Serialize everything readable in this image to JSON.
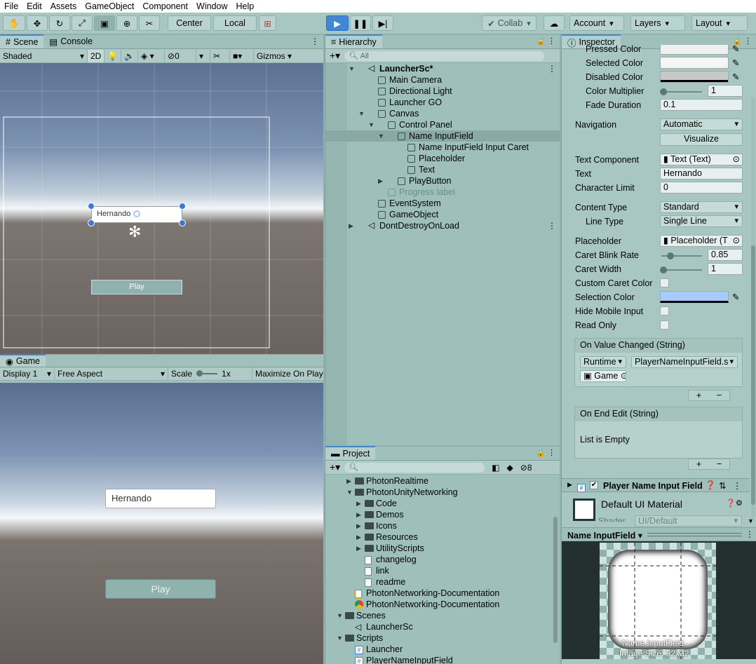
{
  "menu": [
    "File",
    "Edit",
    "Assets",
    "GameObject",
    "Component",
    "Window",
    "Help"
  ],
  "toolbar": {
    "center_label": "Center",
    "local_label": "Local",
    "collab_label": "Collab",
    "account_label": "Account",
    "layers_label": "Layers",
    "layout_label": "Layout"
  },
  "scene": {
    "tab_scene": "Scene",
    "tab_console": "Console",
    "shading": "Shaded",
    "mode_2d": "2D",
    "hidden_count": "0",
    "gizmos": "Gizmos",
    "input_text": "Hernando",
    "play_label": "Play"
  },
  "game": {
    "tab": "Game",
    "display": "Display 1",
    "aspect": "Free Aspect",
    "scale_label": "Scale",
    "scale_value": "1x",
    "maximize": "Maximize On Play",
    "input_text": "Hernando",
    "play_label": "Play"
  },
  "hierarchy": {
    "tab": "Hierarchy",
    "search_placeholder": "All",
    "items": [
      {
        "label": "LauncherSc*",
        "depth": 0,
        "expanded": true,
        "bold": true,
        "scene": true
      },
      {
        "label": "Main Camera",
        "depth": 1
      },
      {
        "label": "Directional Light",
        "depth": 1
      },
      {
        "label": "Launcher GO",
        "depth": 1
      },
      {
        "label": "Canvas",
        "depth": 1,
        "expanded": true
      },
      {
        "label": "Control Panel",
        "depth": 2,
        "expanded": true
      },
      {
        "label": "Name InputField",
        "depth": 3,
        "expanded": true,
        "selected": true
      },
      {
        "label": "Name InputField Input Caret",
        "depth": 4
      },
      {
        "label": "Placeholder",
        "depth": 4
      },
      {
        "label": "Text",
        "depth": 4
      },
      {
        "label": "PlayButton",
        "depth": 3,
        "collapsed": true
      },
      {
        "label": "Progress label",
        "depth": 2,
        "disabled": true
      },
      {
        "label": "EventSystem",
        "depth": 1
      },
      {
        "label": "GameObject",
        "depth": 1
      },
      {
        "label": "DontDestroyOnLoad",
        "depth": 0,
        "collapsed": true,
        "scene": true
      }
    ]
  },
  "project": {
    "tab": "Project",
    "hidden_count": "8",
    "items": [
      {
        "label": "PhotonRealtime",
        "depth": 1,
        "type": "folder",
        "arrow": "▶"
      },
      {
        "label": "PhotonUnityNetworking",
        "depth": 1,
        "type": "folder",
        "arrow": "▼"
      },
      {
        "label": "Code",
        "depth": 2,
        "type": "folder",
        "arrow": "▶"
      },
      {
        "label": "Demos",
        "depth": 2,
        "type": "folder",
        "arrow": "▶"
      },
      {
        "label": "Icons",
        "depth": 2,
        "type": "folder",
        "arrow": "▶"
      },
      {
        "label": "Resources",
        "depth": 2,
        "type": "folder",
        "arrow": "▶"
      },
      {
        "label": "UtilityScripts",
        "depth": 2,
        "type": "folder",
        "arrow": "▶"
      },
      {
        "label": "changelog",
        "depth": 2,
        "type": "file"
      },
      {
        "label": "link",
        "depth": 2,
        "type": "file"
      },
      {
        "label": "readme",
        "depth": 2,
        "type": "file"
      },
      {
        "label": "PhotonNetworking-Documentation",
        "depth": 1,
        "type": "doc"
      },
      {
        "label": "PhotonNetworking-Documentation",
        "depth": 1,
        "type": "chrome"
      },
      {
        "label": "Scenes",
        "depth": 0,
        "type": "folder",
        "arrow": "▼"
      },
      {
        "label": "LauncherSc",
        "depth": 1,
        "type": "scene"
      },
      {
        "label": "Scripts",
        "depth": 0,
        "type": "folder",
        "arrow": "▼"
      },
      {
        "label": "Launcher",
        "depth": 1,
        "type": "script"
      },
      {
        "label": "PlayerNameInputField",
        "depth": 1,
        "type": "script"
      }
    ]
  },
  "inspector": {
    "tab": "Inspector",
    "pressed_color": "Pressed Color",
    "selected_color": "Selected Color",
    "disabled_color": "Disabled Color",
    "color_multiplier": "Color Multiplier",
    "color_multiplier_value": "1",
    "fade_duration": "Fade Duration",
    "fade_duration_value": "0.1",
    "navigation": "Navigation",
    "navigation_value": "Automatic",
    "visualize": "Visualize",
    "text_component": "Text Component",
    "text_component_value": "Text (Text)",
    "text": "Text",
    "text_value": "Hernando",
    "character_limit": "Character Limit",
    "character_limit_value": "0",
    "content_type": "Content Type",
    "content_type_value": "Standard",
    "line_type": "Line Type",
    "line_type_value": "Single Line",
    "placeholder": "Placeholder",
    "placeholder_value": "Placeholder (T",
    "caret_blink_rate": "Caret Blink Rate",
    "caret_blink_rate_value": "0.85",
    "caret_width": "Caret Width",
    "caret_width_value": "1",
    "custom_caret_color": "Custom Caret Color",
    "selection_color": "Selection Color",
    "hide_mobile_input": "Hide Mobile Input",
    "read_only": "Read Only",
    "on_value_changed": "On Value Changed (String)",
    "runtime": "Runtime",
    "function": "PlayerNameInputField.s",
    "target": "Game",
    "on_end_edit": "On End Edit (String)",
    "list_empty": "List is Empty",
    "component_name": "Player Name Input Field",
    "material_name": "Default UI Material",
    "shader_label": "Shader",
    "shader_value": "UI/Default",
    "preview_title": "Name InputField",
    "preview_name": "Name InputField",
    "preview_size": "Image Size: 32x32"
  }
}
